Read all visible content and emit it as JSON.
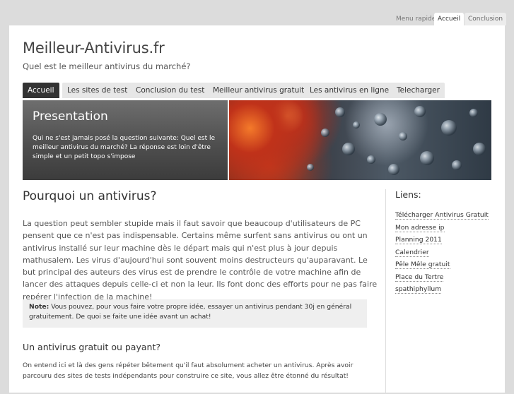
{
  "topbar": {
    "quick_label": "Menu rapide:",
    "tabs": [
      {
        "label": "Accueil",
        "active": true
      },
      {
        "label": "Conclusion",
        "active": false
      }
    ]
  },
  "header": {
    "title": "Meilleur-Antivirus.fr",
    "tagline": "Quel est le meilleur antivirus du marché?"
  },
  "nav": {
    "items": [
      {
        "label": "Accueil",
        "active": true
      },
      {
        "label": "Les sites de test",
        "active": false
      },
      {
        "label": "Conclusion du test",
        "active": false
      },
      {
        "label": "Meilleur antivirus gratuit",
        "active": false
      },
      {
        "label": "Les antivirus en ligne",
        "active": false
      },
      {
        "label": "Telecharger",
        "active": false
      }
    ]
  },
  "banner": {
    "title": "Presentation",
    "text": "Qui ne s'est jamais posé la question suivante: Quel est le meilleur antivirus du marché? La réponse est loin d'être simple et un petit topo s'impose"
  },
  "main": {
    "heading": "Pourquoi un antivirus?",
    "paragraph": "La question peut sembler stupide mais il faut savoir que beaucoup d'utilisateurs de PC pensent que ce n'est pas indispensable. Certains même surfent sans antivirus ou ont un antivirus installé sur leur machine dès le départ mais qui n'est plus à jour depuis mathusalem. Les virus d'aujourd'hui sont souvent moins destructeurs qu'auparavant. Le but principal des auteurs des virus est de prendre le contrôle de votre machine afin de lancer des attaques depuis celle-ci et non la leur. Ils font donc des efforts pour ne pas faire repérer l'infection de la machine!",
    "note_label": "Note:",
    "note_text": " Vous pouvez, pour vous faire votre propre idée, essayer un antivirus pendant 30j en général gratuitement. De quoi se faite une idée avant un achat!",
    "subheading": "Un antivirus gratuit ou payant?",
    "paragraph2": "On entend ici et là des gens répéter bêtement qu'il faut absolument acheter un antivirus. Après avoir parcouru des sites de tests indépendants pour construire ce site, vous allez être étonné du résultat!"
  },
  "sidebar": {
    "title": "Liens:",
    "links": [
      "Télécharger Antivirus Gratuit",
      "Mon adresse ip",
      "Planning 2011",
      "Calendrier",
      "Pêle Mêle gratuit",
      "Place du Tertre",
      "spathiphyllum"
    ]
  },
  "colors": {
    "background": "#dcdcdc",
    "page": "#ffffff",
    "active_tab": "#333333",
    "tab": "#e7e7e7",
    "note_bg": "#efefef"
  }
}
